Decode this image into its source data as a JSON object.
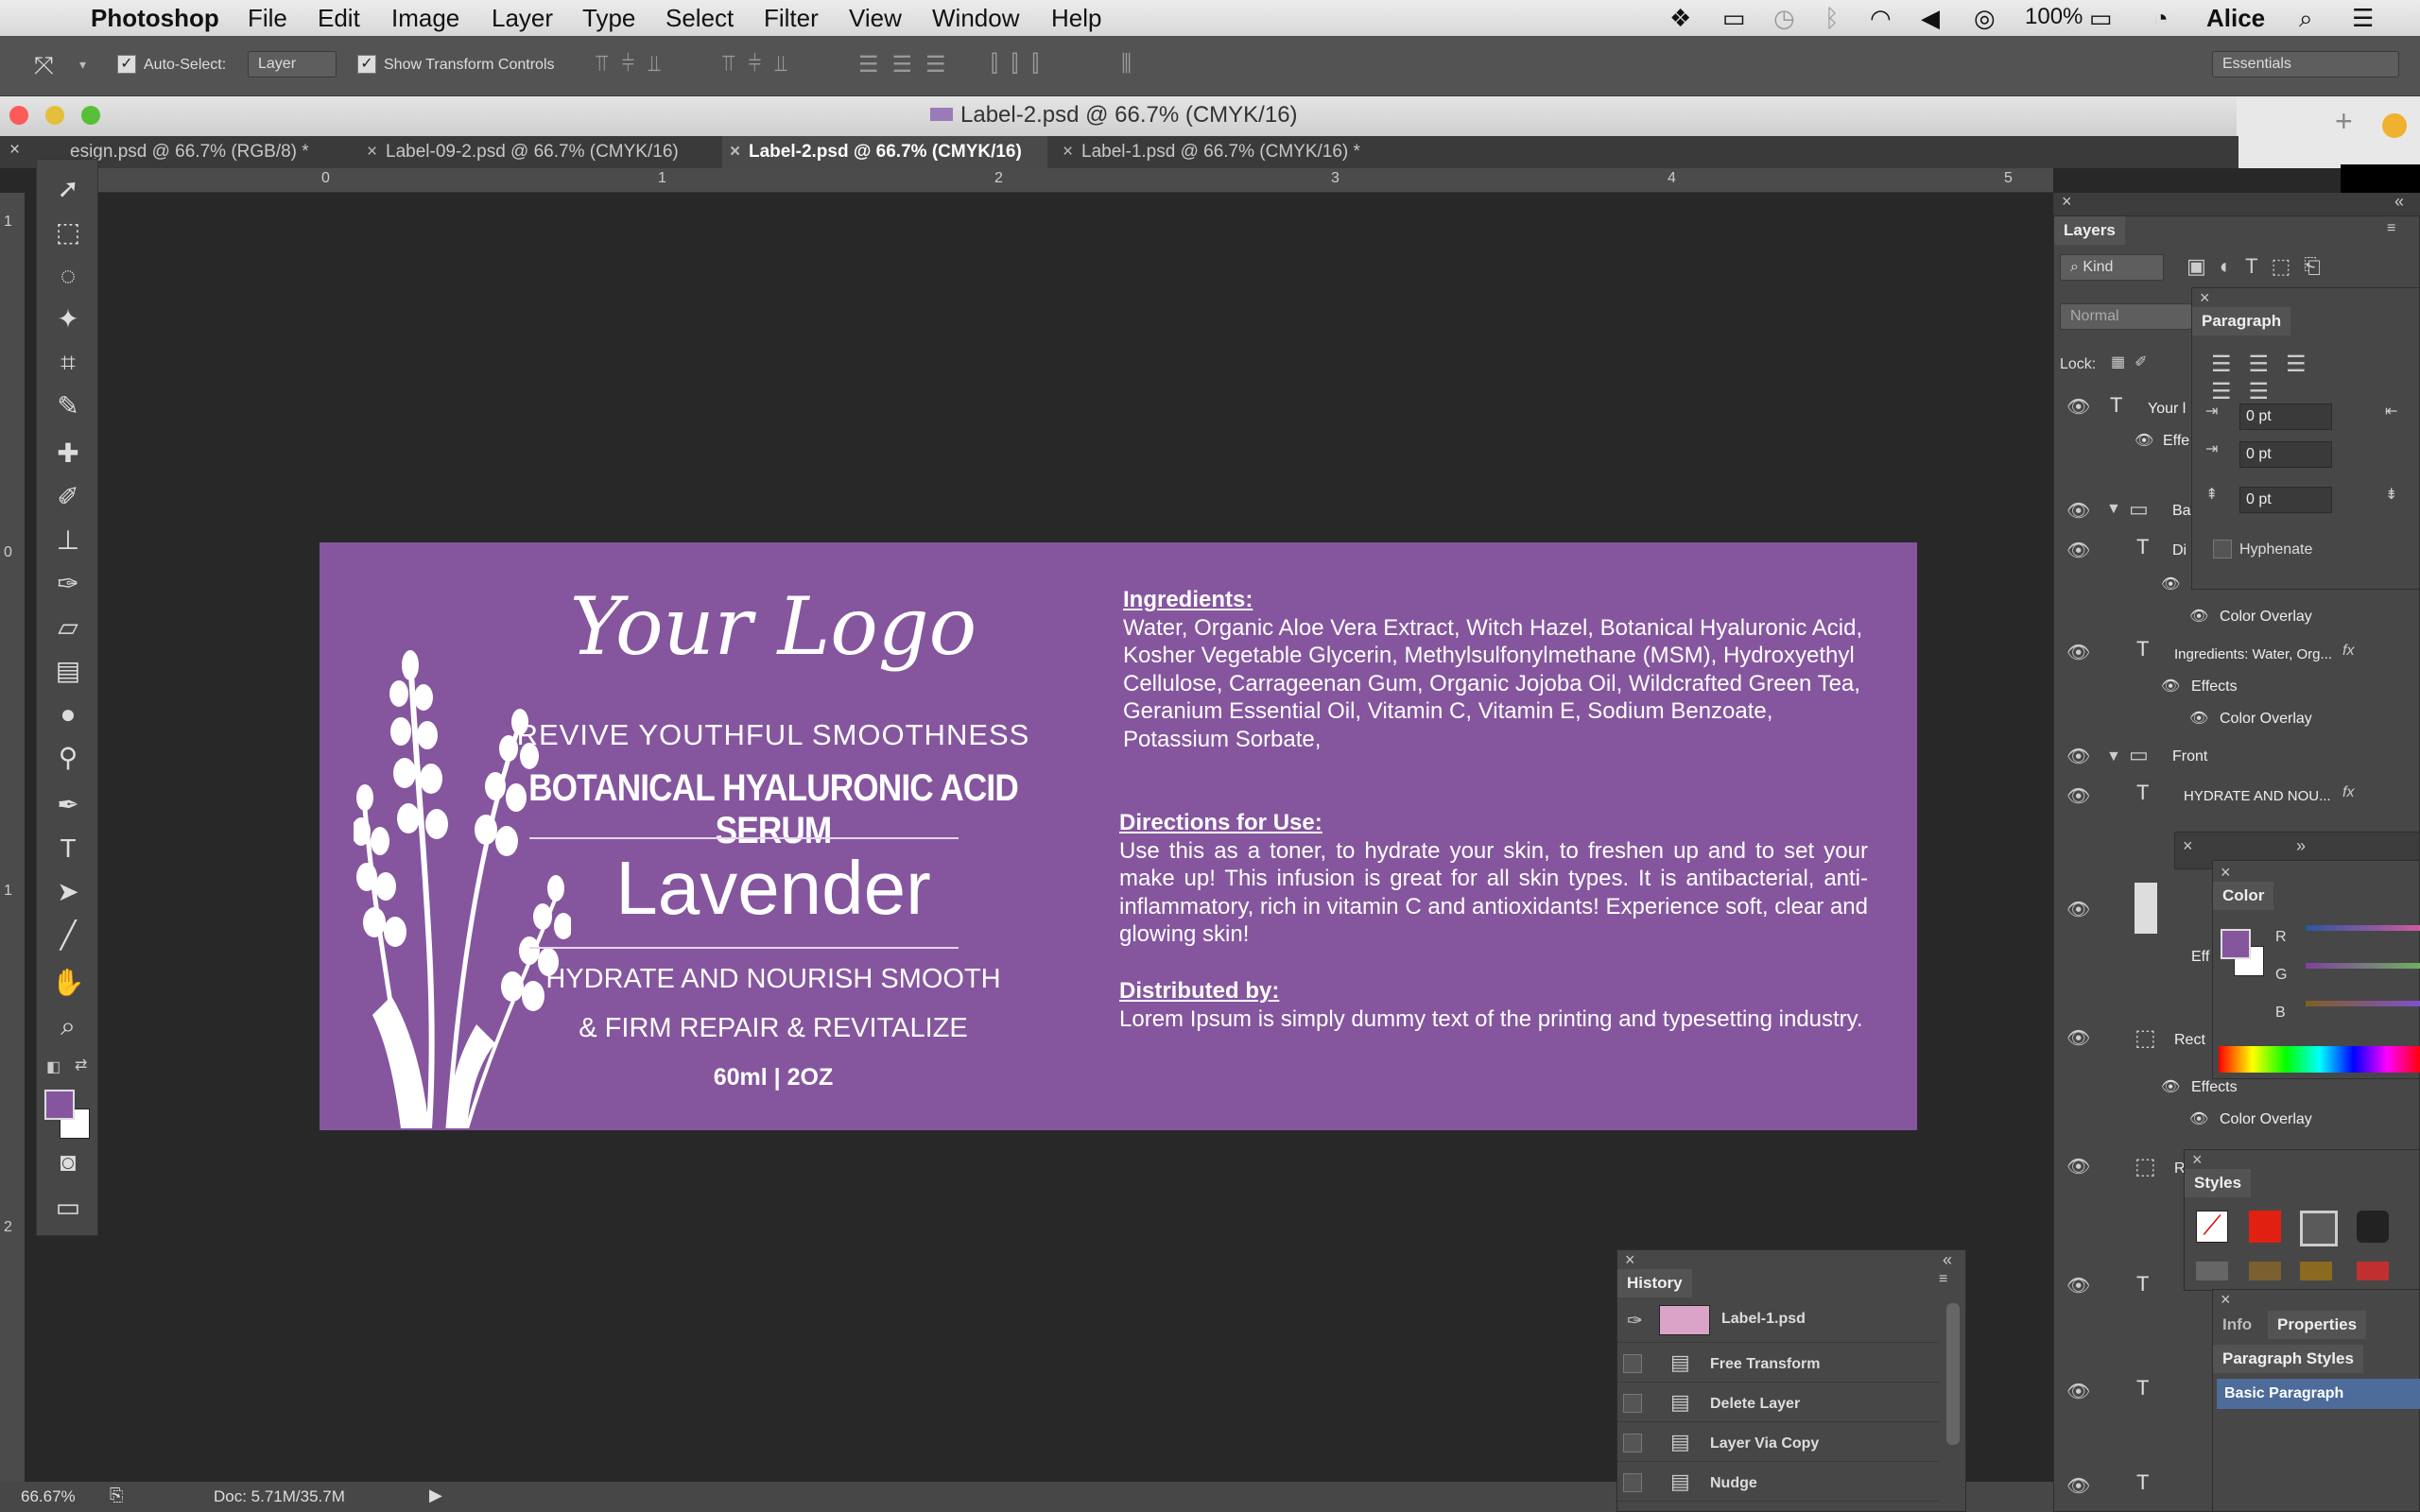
{
  "menubar": {
    "app": "Photoshop",
    "items": [
      "File",
      "Edit",
      "Image",
      "Layer",
      "Type",
      "Select",
      "Filter",
      "View",
      "Window",
      "Help"
    ],
    "battery": "100%",
    "user": "Alice"
  },
  "options": {
    "auto_select_label": "Auto-Select:",
    "auto_select_value": "Layer",
    "show_transform_label": "Show Transform Controls",
    "workspace": "Essentials"
  },
  "window": {
    "title": "Label-2.psd @ 66.7% (CMYK/16)"
  },
  "tabs": [
    {
      "label": "esign.psd @ 66.7% (RGB/8) *",
      "active": false
    },
    {
      "label": "Label-09-2.psd @ 66.7% (CMYK/16)",
      "active": false
    },
    {
      "label": "Label-2.psd @ 66.7% (CMYK/16)",
      "active": true
    },
    {
      "label": "Label-1.psd @ 66.7% (CMYK/16) *",
      "active": false
    }
  ],
  "ruler": {
    "h": [
      "0",
      "1",
      "2",
      "3",
      "4",
      "5"
    ],
    "v": [
      "1",
      "0",
      "1",
      "2"
    ]
  },
  "label": {
    "logo": "Your Logo",
    "tagline": "REVIVE YOUTHFUL SMOOTHNESS",
    "product": "BOTANICAL HYALURONIC ACID SERUM",
    "scent": "Lavender",
    "benefit1": "HYDRATE AND NOURISH SMOOTH",
    "benefit2": "& FIRM REPAIR & REVITALIZE",
    "size": "60ml | 2OZ",
    "ingredients_h": "Ingredients:",
    "ingredients": "Water, Organic Aloe Vera Extract, Witch Hazel, Botanical Hyaluronic Acid, Kosher Vegetable Glycerin, Methylsulfonylmethane (MSM), Hydroxyethyl Cellulose, Carrageenan Gum, Organic Jojoba Oil, Wildcrafted Green Tea, Geranium Essential Oil, Vitamin C, Vitamin E, Sodium Benzoate, Potassium Sorbate,",
    "directions_h": "Directions for Use:",
    "directions": "Use this as a toner, to hydrate your skin, to freshen up and to set your make up! This infusion is great for all skin types. It is antibacterial, anti-inflammatory, rich in vitamin C and antioxidants! Experience soft, clear and glowing skin!",
    "distributed_h": "Distributed by:",
    "distributed": "Lorem Ipsum is simply dummy text of the printing and typesetting industry."
  },
  "status": {
    "zoom": "66.67%",
    "doc": "Doc: 5.71M/35.7M"
  },
  "layers": {
    "title": "Layers",
    "kind": "Kind",
    "blend": "Normal",
    "lock": "Lock:",
    "rows": {
      "r1": "Your l",
      "r1b": "Effe",
      "r2": "Ba",
      "r3": "Di",
      "effects": "Effects",
      "color_overlay": "Color Overlay",
      "r4": "Ingredients: Water, Org...",
      "r5": "Front",
      "r6": "HYDRATE AND NOU...",
      "r7": "Eff",
      "r8": "Rect",
      "r9": "R",
      "fx": "fx"
    }
  },
  "paragraph": {
    "title": "Paragraph",
    "v1": "0 pt",
    "v2": "0 pt",
    "v3": "0 pt",
    "hyphenate": "Hyphenate"
  },
  "color": {
    "title": "Color",
    "r": "R",
    "g": "G",
    "b": "B",
    "fg": "#85569e"
  },
  "styles": {
    "title": "Styles"
  },
  "info": {
    "tab1": "Info",
    "tab2": "Properties",
    "para_styles": "Paragraph Styles",
    "basic": "Basic Paragraph"
  },
  "history": {
    "title": "History",
    "snapshot": "Label-1.psd",
    "items": [
      "Free Transform",
      "Delete Layer",
      "Layer Via Copy",
      "Nudge"
    ]
  }
}
